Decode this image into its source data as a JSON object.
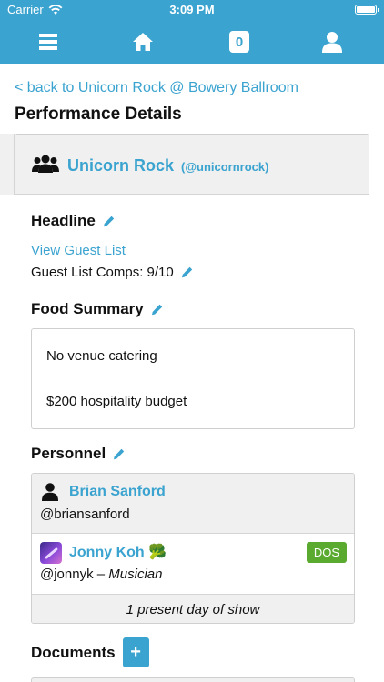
{
  "status_bar": {
    "carrier": "Carrier",
    "time": "3:09 PM"
  },
  "nav": {
    "notification_count": "0"
  },
  "back_link": "< back to Unicorn Rock @ Bowery Ballroom",
  "page_title": "Performance Details",
  "artist": {
    "name": "Unicorn Rock",
    "handle": "(@unicornrock)"
  },
  "headline": {
    "title": "Headline",
    "guest_list_link": "View Guest List",
    "guest_list_comps": "Guest List Comps: 9/10"
  },
  "food_summary": {
    "title": "Food Summary",
    "lines": [
      "No venue catering",
      "$200 hospitality budget"
    ]
  },
  "personnel": {
    "title": "Personnel",
    "people": [
      {
        "name": "Brian Sanford",
        "handle": "@briansanford"
      },
      {
        "name": "Jonny Koh",
        "emoji": "🥦",
        "handle": "@jonnyk",
        "separator": " – ",
        "role": "Musician",
        "badge": "DOS"
      }
    ],
    "footer": "1 present day of show"
  },
  "documents": {
    "title": "Documents",
    "add_label": "+"
  },
  "colors": {
    "brand": "#3aa3cf",
    "badge_green": "#5aaa2f",
    "panel_gray": "#f0f0f0"
  },
  "icons": [
    "wifi-icon",
    "battery-icon",
    "menu-icon",
    "home-icon",
    "user-icon",
    "group-icon",
    "pencil-icon",
    "person-icon",
    "avatar-image"
  ]
}
